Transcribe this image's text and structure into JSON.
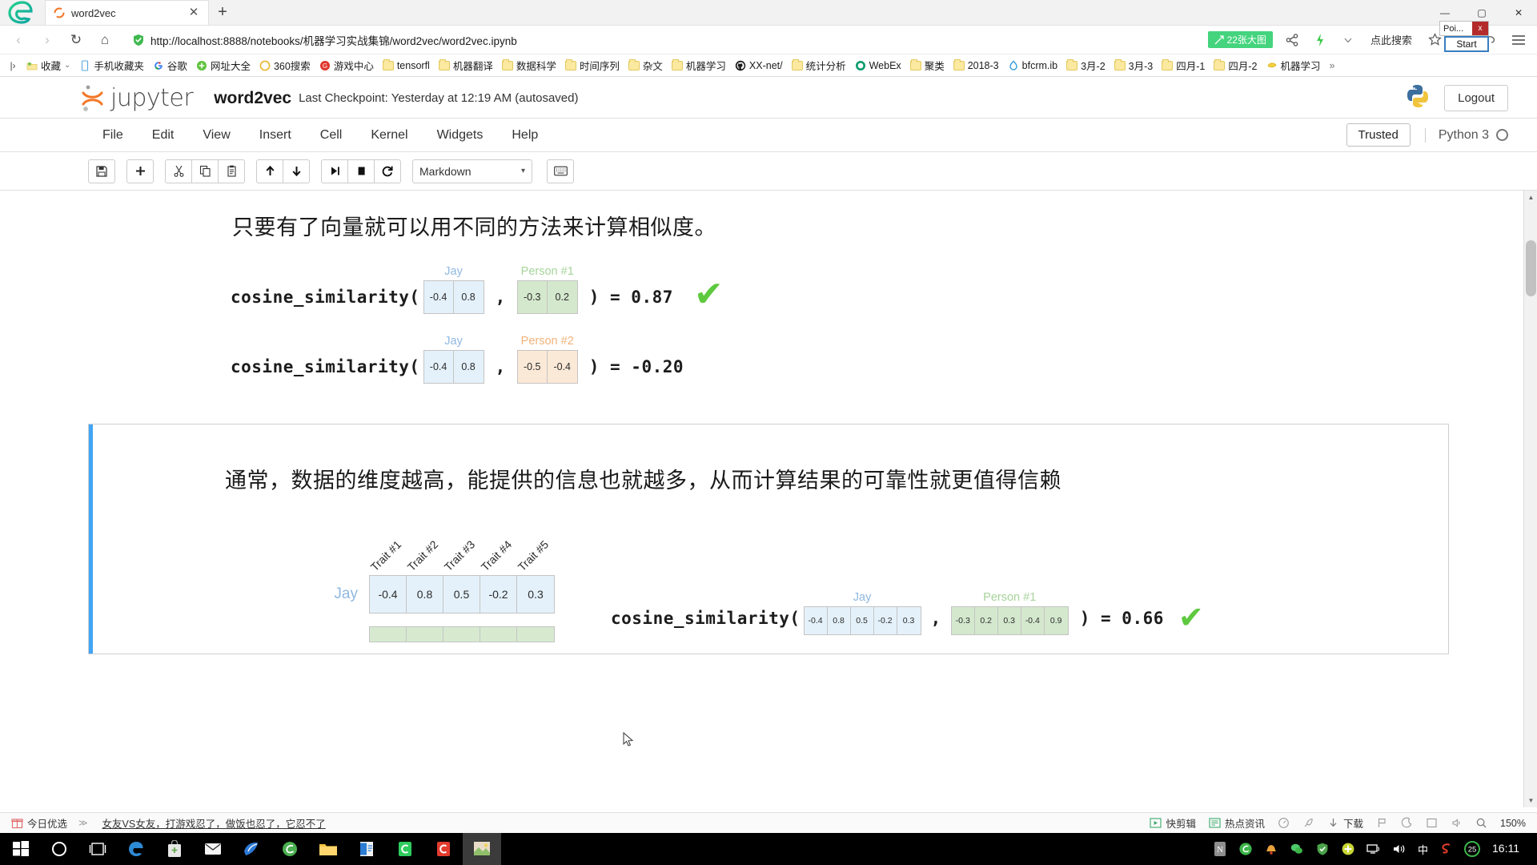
{
  "browser": {
    "tab": {
      "title": "word2vec",
      "close_label": "✕"
    },
    "new_tab_label": "+",
    "window_controls": {
      "minimize": "—",
      "maximize": "▢",
      "close": "✕"
    },
    "nav": {
      "back": "‹",
      "forward": "›",
      "refresh": "↻",
      "home": "⌂"
    },
    "url": "http://localhost:8888/notebooks/机器学习实战集锦/word2vec/word2vec.ipynb",
    "image_badge": "22张大图",
    "search_placeholder": "点此搜索",
    "poi_widget": {
      "label": "Poi...",
      "close": "x",
      "start": "Start"
    }
  },
  "bookmarks": [
    {
      "label": "收藏",
      "icon": "star-folder-icon",
      "has_caret": true
    },
    {
      "label": "手机收藏夹",
      "icon": "phone-icon"
    },
    {
      "label": "谷歌",
      "icon": "google-icon"
    },
    {
      "label": "网址大全",
      "icon": "green-plus-icon"
    },
    {
      "label": "360搜索",
      "icon": "circle-icon"
    },
    {
      "label": "游戏中心",
      "icon": "red-g-icon"
    },
    {
      "label": "tensorfl",
      "icon": "folder-icon"
    },
    {
      "label": "机器翻译",
      "icon": "folder-icon"
    },
    {
      "label": "数据科学",
      "icon": "folder-icon"
    },
    {
      "label": "时间序列",
      "icon": "folder-icon"
    },
    {
      "label": "杂文",
      "icon": "folder-icon"
    },
    {
      "label": "机器学习",
      "icon": "folder-icon"
    },
    {
      "label": "XX-net/",
      "icon": "github-icon"
    },
    {
      "label": "统计分析",
      "icon": "folder-icon"
    },
    {
      "label": "WebEx",
      "icon": "webex-icon"
    },
    {
      "label": "聚类",
      "icon": "folder-icon"
    },
    {
      "label": "2018-3",
      "icon": "folder-icon"
    },
    {
      "label": "bfcrm.ib",
      "icon": "blue-drop-icon"
    },
    {
      "label": "3月-2",
      "icon": "folder-icon"
    },
    {
      "label": "3月-3",
      "icon": "folder-icon"
    },
    {
      "label": "四月-1",
      "icon": "folder-icon"
    },
    {
      "label": "四月-2",
      "icon": "folder-icon"
    },
    {
      "label": "机器学习",
      "icon": "yellow-bird-icon"
    }
  ],
  "bookmarks_overflow": "»",
  "jupyter": {
    "logo_text": "jupyter",
    "notebook_name": "word2vec",
    "checkpoint": "Last Checkpoint: Yesterday at 12:19 AM (autosaved)",
    "logout_label": "Logout",
    "menus": [
      "File",
      "Edit",
      "View",
      "Insert",
      "Cell",
      "Kernel",
      "Widgets",
      "Help"
    ],
    "trusted_label": "Trusted",
    "kernel_name": "Python 3",
    "toolbar": {
      "save": "save-icon",
      "add": "add-cell-icon",
      "cut": "cut-icon",
      "copy": "copy-icon",
      "paste": "paste-icon",
      "move_up": "move-up-icon",
      "move_down": "move-down-icon",
      "run": "run-icon",
      "stop": "stop-icon",
      "restart": "restart-icon",
      "cell_type": "Markdown",
      "cell_type_caret": "▾",
      "keyboard": "keyboard-icon"
    }
  },
  "notebook": {
    "cell1": {
      "heading": "只要有了向量就可以用不同的方法来计算相似度。",
      "rows": [
        {
          "fn_open": "cosine_similarity(",
          "labels": {
            "a": "Jay",
            "b": "Person #1"
          },
          "vec_a": [
            "-0.4",
            "0.8"
          ],
          "vec_b": [
            "-0.3",
            "0.2"
          ],
          "comma": ",",
          "fn_close": ") = 0.87",
          "result": "0.87",
          "check": "✔"
        },
        {
          "fn_open": "cosine_similarity(",
          "labels": {
            "a": "Jay",
            "b": "Person #2"
          },
          "vec_a": [
            "-0.4",
            "0.8"
          ],
          "vec_b": [
            "-0.5",
            "-0.4"
          ],
          "comma": ",",
          "fn_close": ") = -0.20",
          "result": "-0.20",
          "check": ""
        }
      ]
    },
    "cell2": {
      "heading": "通常，数据的维度越高，能提供的信息也就越多，从而计算结果的可靠性就更值得信赖",
      "trait_headers": [
        "Trait #1",
        "Trait #2",
        "Trait #3",
        "Trait #4",
        "Trait #5"
      ],
      "trait_rows": [
        {
          "name": "Jay",
          "values": [
            "-0.4",
            "0.8",
            "0.5",
            "-0.2",
            "0.3"
          ],
          "color": "jay"
        },
        {
          "name": "",
          "values": [
            "",
            "",
            "",
            "",
            ""
          ],
          "color": "p1"
        }
      ],
      "row": {
        "fn_open": "cosine_similarity(",
        "labels": {
          "a": "Jay",
          "b": "Person #1"
        },
        "vec_a": [
          "-0.4",
          "0.8",
          "0.5",
          "-0.2",
          "0.3"
        ],
        "vec_b": [
          "-0.3",
          "0.2",
          "0.3",
          "-0.4",
          "0.9"
        ],
        "comma": ",",
        "fn_close": ") = 0.66",
        "result": "0.66",
        "check": "✔"
      }
    }
  },
  "statusbar": {
    "left": [
      {
        "label": "今日优选",
        "icon": "gift-icon"
      }
    ],
    "news": "女友VS女友，打游戏忍了，做饭也忍了，它忍不了",
    "news_prefix": "≫",
    "right": [
      {
        "label": "快剪辑",
        "icon": "video-edit-icon"
      },
      {
        "label": "热点资讯",
        "icon": "news-icon"
      },
      {
        "label": "",
        "icon": "speed-icon"
      },
      {
        "label": "",
        "icon": "rocket-icon"
      },
      {
        "label": "下载",
        "icon": "download-icon"
      },
      {
        "label": "",
        "icon": "flag-icon"
      },
      {
        "label": "",
        "icon": "moon-icon"
      },
      {
        "label": "",
        "icon": "window-icon"
      },
      {
        "label": "",
        "icon": "sound-icon"
      },
      {
        "label": "",
        "icon": "search-icon"
      },
      {
        "label": "150%",
        "icon": "zoom-level"
      }
    ]
  },
  "taskbar": {
    "items": [
      {
        "name": "start-button",
        "icon": "windows-icon"
      },
      {
        "name": "cortana-button",
        "icon": "circle-icon"
      },
      {
        "name": "task-view-button",
        "icon": "taskview-icon"
      },
      {
        "name": "edge-button",
        "icon": "edge-icon"
      },
      {
        "name": "store-button",
        "icon": "store-icon"
      },
      {
        "name": "mail-button",
        "icon": "mail-icon"
      },
      {
        "name": "foxmail-button",
        "icon": "foxmail-icon"
      },
      {
        "name": "browser-360-button",
        "icon": "360-icon"
      },
      {
        "name": "explorer-button",
        "icon": "folder-icon"
      },
      {
        "name": "office-button",
        "icon": "office-icon"
      },
      {
        "name": "wechat-button",
        "icon": "green-c-icon"
      },
      {
        "name": "app-red-button",
        "icon": "red-c-icon"
      },
      {
        "name": "active-app-button",
        "icon": "image-app-icon"
      }
    ],
    "tray": [
      {
        "name": "tray-onenote",
        "icon": "n-icon"
      },
      {
        "name": "tray-360",
        "icon": "green-e-icon"
      },
      {
        "name": "tray-notify",
        "icon": "bell-icon"
      },
      {
        "name": "tray-wechat",
        "icon": "wechat-icon"
      },
      {
        "name": "tray-shield",
        "icon": "shield-icon"
      },
      {
        "name": "tray-plus",
        "icon": "plus-icon"
      },
      {
        "name": "tray-network",
        "icon": "network-icon"
      },
      {
        "name": "tray-volume",
        "icon": "volume-icon"
      },
      {
        "name": "tray-ime",
        "label": "中"
      },
      {
        "name": "tray-sogou",
        "icon": "sogou-icon"
      },
      {
        "name": "tray-battery",
        "label": "25"
      }
    ],
    "clock": "16:11"
  }
}
